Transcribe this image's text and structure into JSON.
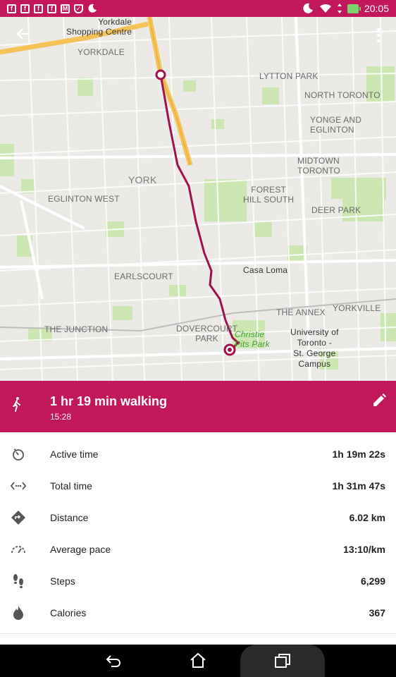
{
  "status_bar": {
    "time": "20:05",
    "notification_icons": [
      "facebook-icon",
      "facebook-icon",
      "facebook-icon",
      "facebook-icon",
      "gmail-icon",
      "shield-icon",
      "moon-icon"
    ]
  },
  "map": {
    "labels": {
      "yorkdale_shopping": "Yorkdale\nShopping Centre",
      "yorkdale": "YORKDALE",
      "lytton_park": "LYTTON PARK",
      "north_toronto": "NORTH TORONTO",
      "yonge_eglinton": "YONGE AND\nEGLINTON",
      "midtown_toronto": "MIDTOWN\nTORONTO",
      "york": "YORK",
      "eglinton_west": "EGLINTON WEST",
      "forest_hill_south": "FOREST\nHILL SOUTH",
      "deer_park": "DEER PARK",
      "casa_loma": "Casa Loma",
      "earlscourt": "EARLSCOURT",
      "the_annex": "THE ANNEX",
      "yorkville": "YORKVILLE",
      "the_junction": "THE JUNCTION",
      "dovercourt_park": "DOVERCOURT\nPARK",
      "christie_pits": "Christie\nPits Park",
      "uoft": "University of\nToronto -\nSt. George\nCampus"
    },
    "route_color": "#a0104e",
    "highway_color": "#f5c257"
  },
  "activity": {
    "title": "1 hr 19 min walking",
    "start_time": "15:28",
    "accent": "#c2185b"
  },
  "stats": [
    {
      "icon": "timer-icon",
      "label": "Active time",
      "value": "1h 19m 22s"
    },
    {
      "icon": "total-time-icon",
      "label": "Total time",
      "value": "1h 31m 47s"
    },
    {
      "icon": "distance-icon",
      "label": "Distance",
      "value": "6.02 km"
    },
    {
      "icon": "pace-icon",
      "label": "Average pace",
      "value": "13:10/km"
    },
    {
      "icon": "steps-icon",
      "label": "Steps",
      "value": "6,299"
    },
    {
      "icon": "calories-icon",
      "label": "Calories",
      "value": "367"
    }
  ]
}
